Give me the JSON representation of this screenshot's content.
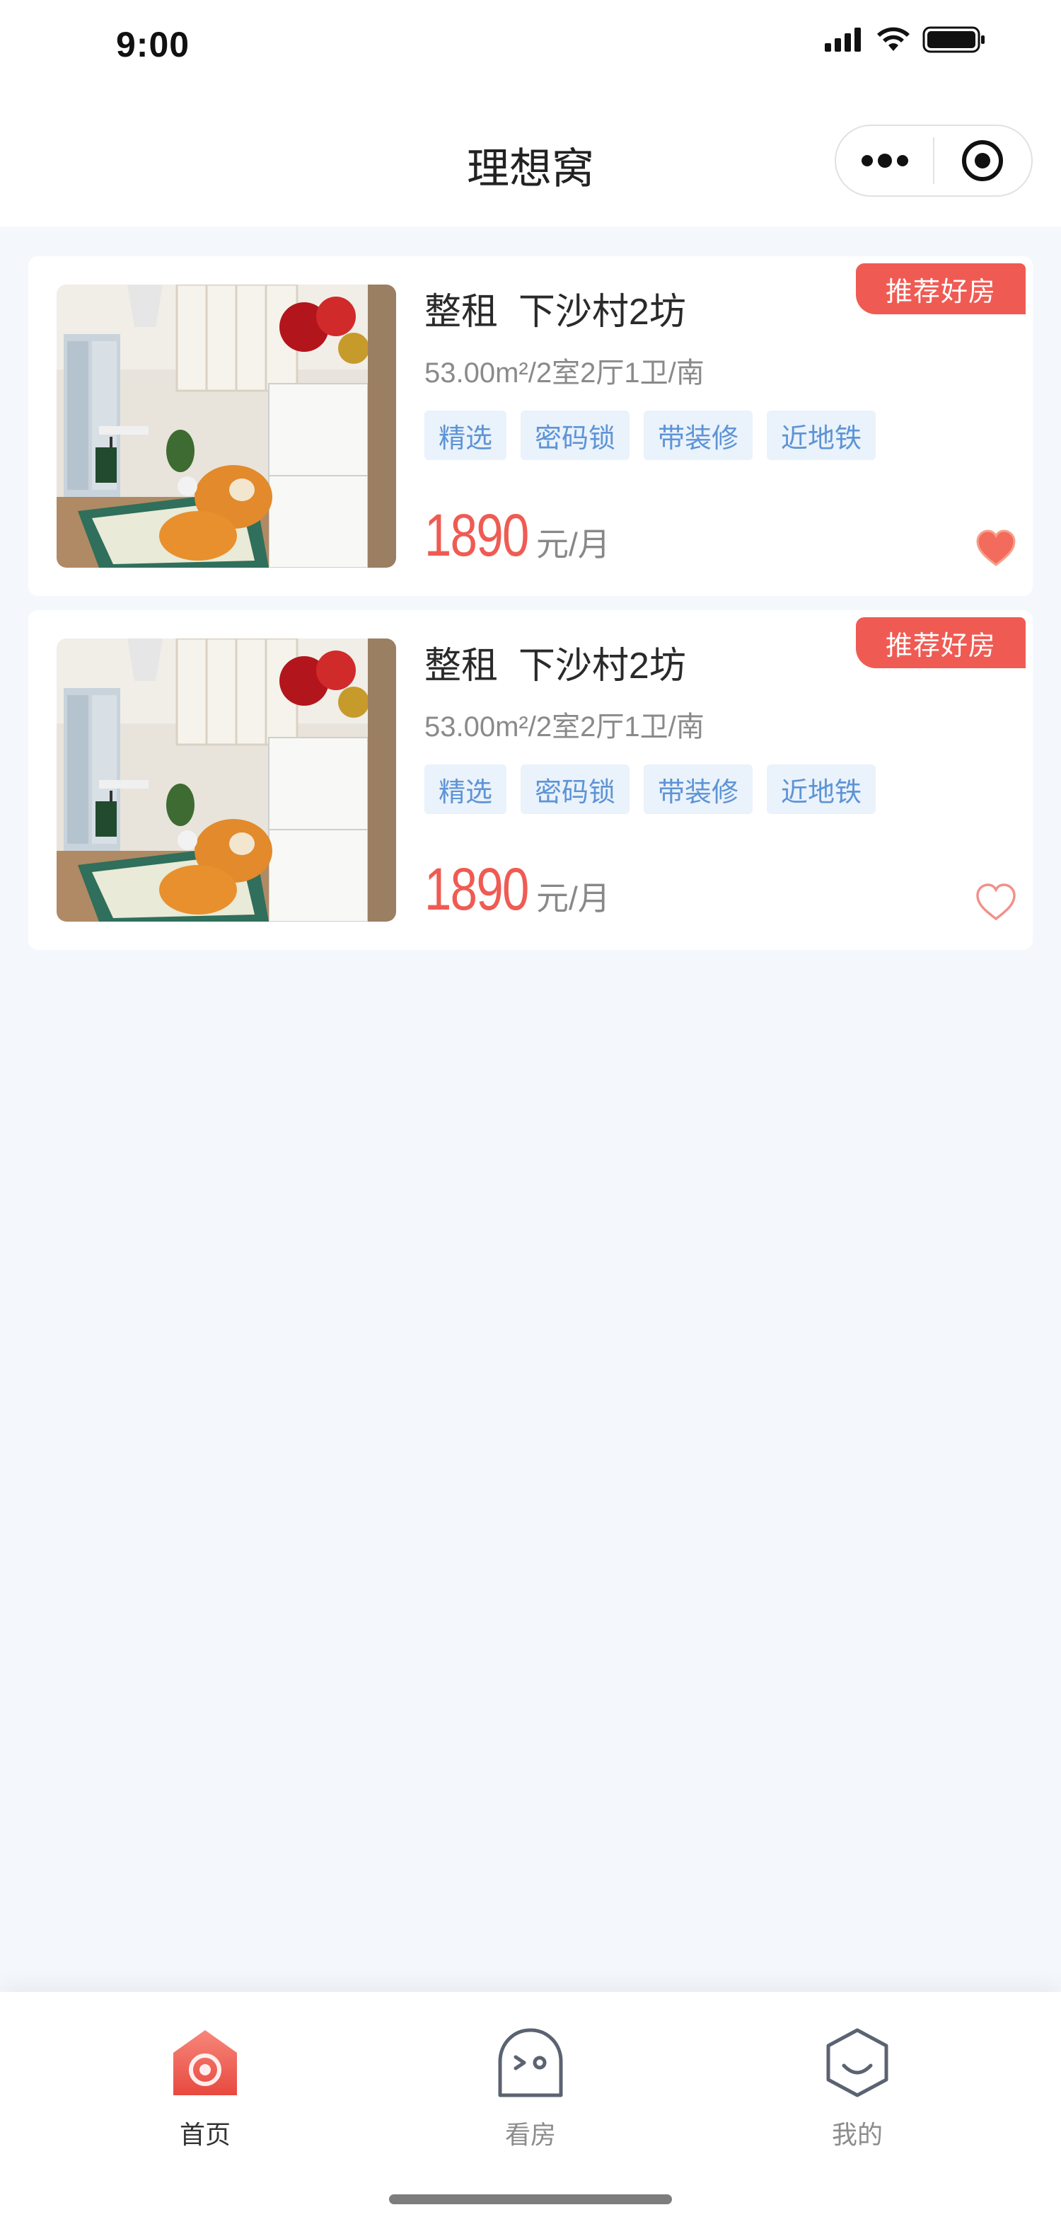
{
  "status_bar": {
    "time": "9:00"
  },
  "nav": {
    "title": "理想窝",
    "more_icon": "more-dots-icon",
    "close_icon": "target-circle-icon"
  },
  "listings": [
    {
      "badge": "推荐好房",
      "title": "整租  下沙村2坊",
      "specs": "53.00m²/2室2厅1卫/南",
      "tags": [
        "精选",
        "密码锁",
        "带装修",
        "近地铁"
      ],
      "price": "1890",
      "price_unit": "元/月",
      "favorited": true
    },
    {
      "badge": "推荐好房",
      "title": "整租  下沙村2坊",
      "specs": "53.00m²/2室2厅1卫/南",
      "tags": [
        "精选",
        "密码锁",
        "带装修",
        "近地铁"
      ],
      "price": "1890",
      "price_unit": "元/月",
      "favorited": false
    }
  ],
  "tab_bar": {
    "items": [
      {
        "label": "首页",
        "icon": "home-icon",
        "active": true
      },
      {
        "label": "看房",
        "icon": "ghost-viewing-icon",
        "active": false
      },
      {
        "label": "我的",
        "icon": "hexagon-profile-icon",
        "active": false
      }
    ]
  },
  "colors": {
    "accent": "#ef5b53",
    "tag_bg": "#eaf2fb",
    "tag_text": "#5d94d6",
    "page_bg": "#f4f8fc"
  }
}
